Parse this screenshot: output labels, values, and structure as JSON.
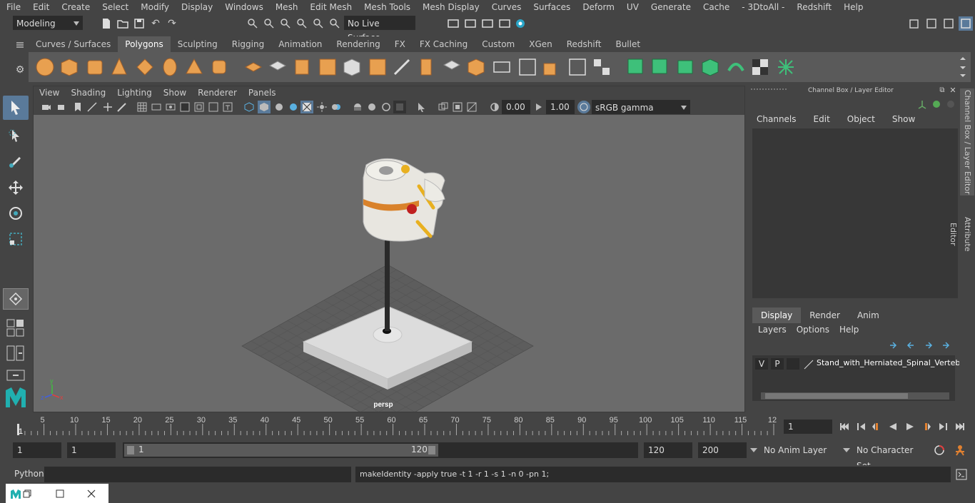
{
  "menu": [
    "File",
    "Edit",
    "Create",
    "Select",
    "Modify",
    "Display",
    "Windows",
    "Mesh",
    "Edit Mesh",
    "Mesh Tools",
    "Mesh Display",
    "Curves",
    "Surfaces",
    "Deform",
    "UV",
    "Generate",
    "Cache",
    "- 3DtoAll -",
    "Redshift",
    "Help"
  ],
  "status": {
    "workspace": "Modeling",
    "live_surface": "No Live Surface"
  },
  "shelf_tabs": [
    {
      "label": "Curves / Surfaces"
    },
    {
      "label": "Polygons",
      "active": true
    },
    {
      "label": "Sculpting"
    },
    {
      "label": "Rigging"
    },
    {
      "label": "Animation"
    },
    {
      "label": "Rendering"
    },
    {
      "label": "FX"
    },
    {
      "label": "FX Caching"
    },
    {
      "label": "Custom"
    },
    {
      "label": "XGen"
    },
    {
      "label": "Redshift"
    },
    {
      "label": "Bullet"
    }
  ],
  "viewport": {
    "menu": [
      "View",
      "Shading",
      "Lighting",
      "Show",
      "Renderer",
      "Panels"
    ],
    "exposure": "0.00",
    "gamma": "1.00",
    "color_space": "sRGB gamma",
    "camera_label": "persp"
  },
  "channel_box": {
    "title": "Channel Box / Layer Editor",
    "menu": [
      "Channels",
      "Edit",
      "Object",
      "Show"
    ]
  },
  "layer_editor": {
    "tabs": [
      {
        "label": "Display",
        "active": true
      },
      {
        "label": "Render"
      },
      {
        "label": "Anim"
      }
    ],
    "menu": [
      "Layers",
      "Options",
      "Help"
    ],
    "layer": {
      "v": "V",
      "p": "P",
      "name": "Stand_with_Herniated_Spinal_Verteb"
    }
  },
  "side_tabs": [
    "Channel Box / Layer Editor",
    "Attribute Editor"
  ],
  "timeline": {
    "ticks": [
      "5",
      "10",
      "15",
      "20",
      "25",
      "30",
      "35",
      "40",
      "45",
      "50",
      "55",
      "60",
      "65",
      "70",
      "75",
      "80",
      "85",
      "90",
      "95",
      "100",
      "105",
      "110",
      "115",
      "12"
    ],
    "start_label": "1",
    "current_frame": "1"
  },
  "range": {
    "start": "1",
    "playback_start": "1",
    "slider_start": "1",
    "slider_end": "120",
    "playback_end": "120",
    "end": "200",
    "anim_layer": "No Anim Layer",
    "character_set": "No Character Set"
  },
  "command": {
    "language": "Python",
    "result": "makeIdentity -apply true -t 1 -r 1 -s 1 -n 0 -pn 1;"
  },
  "colors": {
    "shelf_orange": "#e8a050",
    "shelf_green": "#3ec07a",
    "active_tab": "#5a5a5a",
    "maya_teal": "#20b0b0"
  }
}
